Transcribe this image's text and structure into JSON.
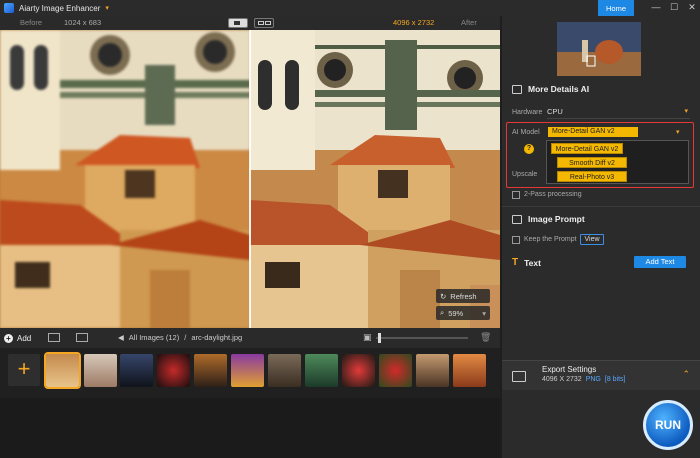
{
  "titlebar": {
    "app_name": "Aiarty Image Enhancer",
    "home_label": "Home",
    "min_glyph": "—",
    "max_glyph": "☐",
    "close_glyph": "✕"
  },
  "compare": {
    "before_label": "Before",
    "before_size": "1024 x 683",
    "after_size": "4096 x 2732",
    "after_label": "After"
  },
  "viewer": {
    "refresh_label": "Refresh",
    "zoom_label": "59%"
  },
  "toolbar": {
    "add_label": "Add",
    "breadcrumb_all": "All Images (12)",
    "breadcrumb_sep": "/",
    "breadcrumb_file": "arc-daylight.jpg",
    "zoom_slider_value": 0.02
  },
  "thumbnails": {
    "count": 12,
    "selected_index": 0
  },
  "panel": {
    "section_details": "More Details AI",
    "hardware_label": "Hardware",
    "hardware_value": "CPU",
    "ai_model_label": "AI Model",
    "ai_model_value": "More-Detail GAN v2",
    "model_options": [
      "More-Detail GAN v2",
      "Smooth Diff v2",
      "Real-Photo v3"
    ],
    "upscale_label": "Upscale",
    "two_pass_label": "2-Pass processing",
    "section_prompt": "Image Prompt",
    "keep_prompt_label": "Keep the Prompt",
    "view_label": "View",
    "section_text": "Text",
    "add_text_label": "Add Text",
    "export_title": "Export Settings",
    "export_size": "4096 X 2732",
    "export_format": "PNG",
    "export_bits": "[8 bits]",
    "run_label": "RUN"
  },
  "colors": {
    "accent": "#f5a623",
    "blue": "#1e88e5",
    "highlight_red": "#e53935",
    "dropdown_yellow": "#f5b800"
  }
}
